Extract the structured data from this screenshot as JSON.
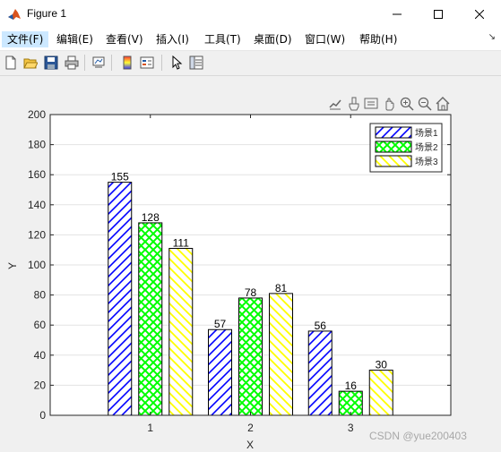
{
  "window": {
    "title": "Figure 1"
  },
  "menu": {
    "items": [
      {
        "label": "文件(F)"
      },
      {
        "label": "编辑(E)"
      },
      {
        "label": "查看(V)"
      },
      {
        "label": "插入(I)"
      },
      {
        "label": "工具(T)"
      },
      {
        "label": "桌面(D)"
      },
      {
        "label": "窗口(W)"
      },
      {
        "label": "帮助(H)"
      }
    ]
  },
  "toolbar": {
    "icons": [
      "new-figure-icon",
      "open-file-icon",
      "save-icon",
      "print-icon",
      "link-plot-icon",
      "insert-colorbar-icon",
      "insert-legend-icon",
      "edit-plot-icon",
      "property-inspector-icon"
    ]
  },
  "axes_toolbar": {
    "icons": [
      "export-icon",
      "brush-icon",
      "data-tips-icon",
      "pan-icon",
      "zoom-in-icon",
      "zoom-out-icon",
      "restore-view-icon"
    ]
  },
  "chart_data": {
    "type": "bar",
    "categories": [
      "1",
      "2",
      "3"
    ],
    "xlabel": "X",
    "ylabel": "Y",
    "ylim": [
      0,
      200
    ],
    "yticks": [
      "0",
      "20",
      "40",
      "60",
      "80",
      "100",
      "120",
      "140",
      "160",
      "180",
      "200"
    ],
    "grid": "y",
    "legend_position": "top-right",
    "series": [
      {
        "name": "场景1",
        "values": [
          155,
          57,
          56
        ],
        "color": "#0000ff",
        "pattern": "diagonal-hatch"
      },
      {
        "name": "场景2",
        "values": [
          128,
          78,
          16
        ],
        "color": "#00ff00",
        "pattern": "cross-hatch"
      },
      {
        "name": "场景3",
        "values": [
          111,
          81,
          30
        ],
        "color": "#ffff00",
        "pattern": "back-diagonal-hatch"
      }
    ],
    "data_labels": [
      [
        "155",
        "57",
        "56"
      ],
      [
        "128",
        "78",
        "16"
      ],
      [
        "111",
        "81",
        "30"
      ]
    ]
  },
  "watermark": "CSDN @yue200403"
}
